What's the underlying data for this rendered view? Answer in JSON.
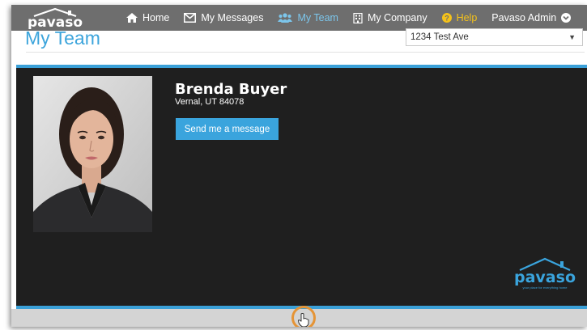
{
  "nav": {
    "logo_text": "pavaso",
    "items": [
      {
        "label": "Home",
        "icon": "home-icon"
      },
      {
        "label": "My Messages",
        "icon": "envelope-icon"
      },
      {
        "label": "My Team",
        "icon": "team-icon",
        "active": true
      },
      {
        "label": "My Company",
        "icon": "building-icon"
      },
      {
        "label": "Help",
        "icon": "question-circle-icon"
      },
      {
        "label": "Pavaso Admin",
        "icon": "chevron-circle-down-icon"
      }
    ]
  },
  "page": {
    "title": "My Team",
    "address_select": {
      "value": "1234 Test Ave"
    }
  },
  "profile": {
    "name": "Brenda Buyer",
    "location": "Vernal, UT 84078",
    "message_button": "Send me a message"
  },
  "watermark": {
    "logo_text": "pavaso",
    "tagline": "your place for everything home"
  },
  "colors": {
    "navbar": "#6e6e6e",
    "accent": "#3aa4dd",
    "active_nav": "#7cc6ec",
    "help": "#f5c21a",
    "panel": "#1f1f1f",
    "cursor_highlight": "#e59436"
  }
}
